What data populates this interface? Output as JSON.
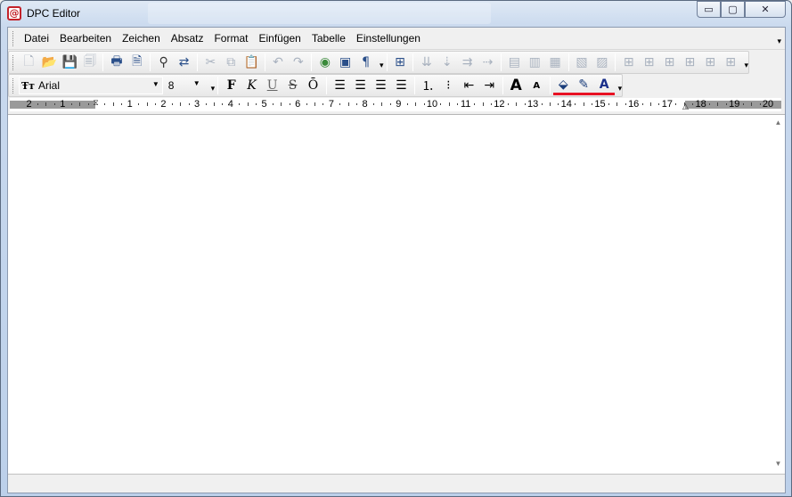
{
  "window": {
    "title": "DPC Editor",
    "background_title": "",
    "controls": {
      "minimize": "▭",
      "maximize": "▢",
      "close": "✕"
    }
  },
  "menu": {
    "items": [
      {
        "label": "Datei"
      },
      {
        "label": "Bearbeiten"
      },
      {
        "label": "Zeichen"
      },
      {
        "label": "Absatz"
      },
      {
        "label": "Format"
      },
      {
        "label": "Einfügen"
      },
      {
        "label": "Tabelle"
      },
      {
        "label": "Einstellungen"
      }
    ]
  },
  "toolbar1": {
    "icons": [
      "new-document-icon",
      "open-folder-icon",
      "save-icon",
      "save-all-icon",
      "print-icon",
      "print-preview-icon",
      "find-icon",
      "replace-icon",
      "cut-icon",
      "copy-icon",
      "paste-icon",
      "undo-icon",
      "redo-icon",
      "insert-image-icon",
      "insert-object-icon",
      "paragraph-marks-icon",
      "insert-field-icon",
      "merge-down-icon",
      "split-down-icon",
      "merge-right-icon",
      "split-right-icon",
      "table-row-icon",
      "table-row-insert-icon",
      "table-row-delete-icon",
      "table-col-icon",
      "table-col-insert-icon",
      "grid-1-icon",
      "grid-2-icon",
      "grid-3-icon",
      "grid-4-icon",
      "grid-5-icon",
      "grid-6-icon"
    ]
  },
  "toolbar2": {
    "font_name": "Arial",
    "font_size": "8",
    "bold_label": "F",
    "italic_label": "K",
    "underline_label": "U",
    "strike_label": "S",
    "overline_label": "Ō",
    "colors": {
      "highlight": "#e81123",
      "pen": "#e81123",
      "font": "#e81123"
    }
  },
  "ruler": {
    "left_numbers": [
      "2",
      "1"
    ],
    "numbers": [
      "1",
      "2",
      "3",
      "4",
      "5",
      "6",
      "7",
      "8",
      "9",
      "10",
      "11",
      "12",
      "13",
      "14",
      "15",
      "16",
      "17",
      "18",
      "19",
      "20"
    ]
  },
  "status": {
    "text": ""
  }
}
